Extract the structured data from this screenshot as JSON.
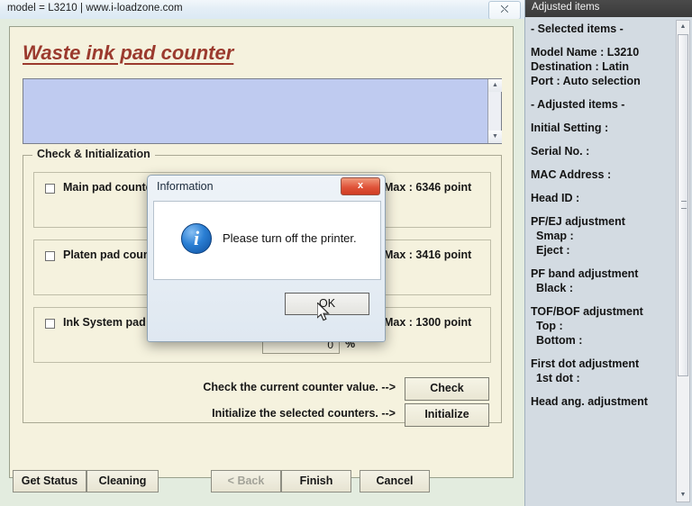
{
  "main_window": {
    "title": "model = L3210 | www.i-loadzone.com",
    "close_icon": "close-icon",
    "heading": "Waste ink pad counter",
    "log_value": "",
    "group": {
      "legend": "Check & Initialization",
      "rows": [
        {
          "label": "Main pad counter",
          "max_text": "Max : 6346 point",
          "max_value": 6346,
          "value": "",
          "percent": "",
          "checked": false
        },
        {
          "label": "Platen pad counter",
          "max_text": "Max : 3416 point",
          "max_value": 3416,
          "value": "",
          "percent": "",
          "checked": false
        },
        {
          "label": "Ink System pad counter",
          "max_text": "Max : 1300 point",
          "max_value": 1300,
          "value": "0",
          "percent": "%",
          "checked": false
        }
      ],
      "actions": [
        {
          "caption": "Check the current counter value. -->",
          "button": "Check"
        },
        {
          "caption": "Initialize the selected counters. -->",
          "button": "Initialize"
        }
      ]
    },
    "bottom_buttons": [
      {
        "label": "Get Status",
        "disabled": false
      },
      {
        "label": "Cleaning",
        "disabled": false
      },
      {
        "label": "< Back",
        "disabled": true
      },
      {
        "label": "Finish",
        "disabled": false
      },
      {
        "label": "Cancel",
        "disabled": false
      }
    ]
  },
  "dialog": {
    "title": "Information",
    "close_icon": "close-icon",
    "close_label": "x",
    "icon": "info-icon",
    "icon_glyph": "i",
    "message": "Please turn off the printer.",
    "ok_label": "OK"
  },
  "sidebar": {
    "title": "Adjusted items",
    "scrollbar": {
      "up_arrow": "▲",
      "down_arrow": "▼"
    },
    "lines": [
      {
        "text": "- Selected items -",
        "indent": false
      },
      {
        "text": "",
        "gap": true
      },
      {
        "text": "Model Name : L3210",
        "indent": false
      },
      {
        "text": "Destination : Latin",
        "indent": false
      },
      {
        "text": "Port : Auto selection",
        "indent": false
      },
      {
        "text": "",
        "gap": true
      },
      {
        "text": "- Adjusted items -",
        "indent": false
      },
      {
        "text": "",
        "gap": true
      },
      {
        "text": "Initial Setting :",
        "indent": false
      },
      {
        "text": "",
        "gap": true
      },
      {
        "text": "Serial No. :",
        "indent": false
      },
      {
        "text": "",
        "gap": true
      },
      {
        "text": "MAC Address :",
        "indent": false
      },
      {
        "text": "",
        "gap": true
      },
      {
        "text": "Head ID :",
        "indent": false
      },
      {
        "text": "",
        "gap": true
      },
      {
        "text": "PF/EJ adjustment",
        "indent": false
      },
      {
        "text": "Smap :",
        "indent": true
      },
      {
        "text": "Eject :",
        "indent": true
      },
      {
        "text": "",
        "gap": true
      },
      {
        "text": "PF band adjustment",
        "indent": false
      },
      {
        "text": "Black :",
        "indent": true
      },
      {
        "text": "",
        "gap": true
      },
      {
        "text": "TOF/BOF adjustment",
        "indent": false
      },
      {
        "text": "Top :",
        "indent": true
      },
      {
        "text": "Bottom :",
        "indent": true
      },
      {
        "text": "",
        "gap": true
      },
      {
        "text": "First dot adjustment",
        "indent": false
      },
      {
        "text": "1st dot :",
        "indent": true
      },
      {
        "text": "",
        "gap": true
      },
      {
        "text": "Head ang. adjustment",
        "indent": false
      }
    ]
  },
  "colors": {
    "panel_bg": "#f5f2de",
    "window_bg": "#e3ecdf",
    "heading": "#9b3a2e",
    "log_bg": "#bfcbf0",
    "sidebar_bg": "#d3dbe2",
    "dialog_close": "#e0543a"
  }
}
